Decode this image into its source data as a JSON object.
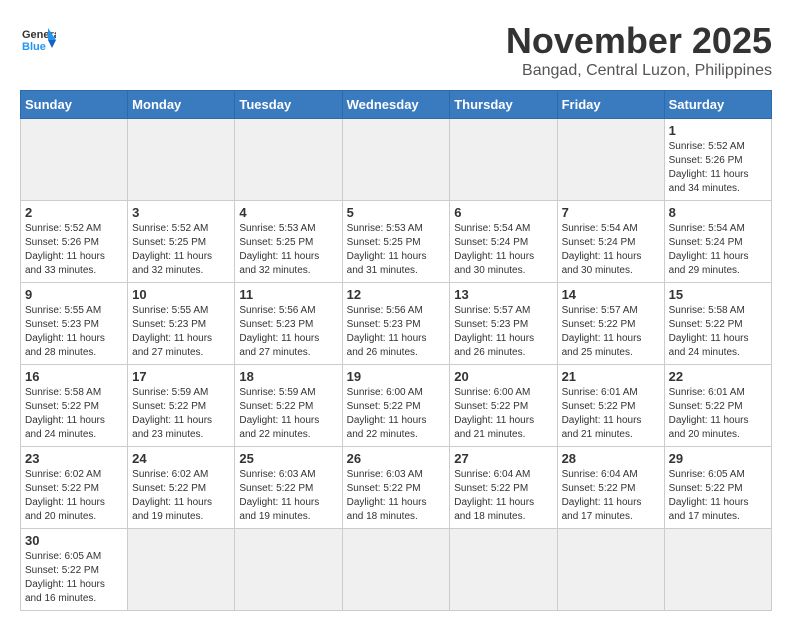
{
  "header": {
    "logo_general": "General",
    "logo_blue": "Blue",
    "month_title": "November 2025",
    "location": "Bangad, Central Luzon, Philippines"
  },
  "weekdays": [
    "Sunday",
    "Monday",
    "Tuesday",
    "Wednesday",
    "Thursday",
    "Friday",
    "Saturday"
  ],
  "weeks": [
    [
      {
        "day": "",
        "info": ""
      },
      {
        "day": "",
        "info": ""
      },
      {
        "day": "",
        "info": ""
      },
      {
        "day": "",
        "info": ""
      },
      {
        "day": "",
        "info": ""
      },
      {
        "day": "",
        "info": ""
      },
      {
        "day": "1",
        "info": "Sunrise: 5:52 AM\nSunset: 5:26 PM\nDaylight: 11 hours\nand 34 minutes."
      }
    ],
    [
      {
        "day": "2",
        "info": "Sunrise: 5:52 AM\nSunset: 5:26 PM\nDaylight: 11 hours\nand 33 minutes."
      },
      {
        "day": "3",
        "info": "Sunrise: 5:52 AM\nSunset: 5:25 PM\nDaylight: 11 hours\nand 32 minutes."
      },
      {
        "day": "4",
        "info": "Sunrise: 5:53 AM\nSunset: 5:25 PM\nDaylight: 11 hours\nand 32 minutes."
      },
      {
        "day": "5",
        "info": "Sunrise: 5:53 AM\nSunset: 5:25 PM\nDaylight: 11 hours\nand 31 minutes."
      },
      {
        "day": "6",
        "info": "Sunrise: 5:54 AM\nSunset: 5:24 PM\nDaylight: 11 hours\nand 30 minutes."
      },
      {
        "day": "7",
        "info": "Sunrise: 5:54 AM\nSunset: 5:24 PM\nDaylight: 11 hours\nand 30 minutes."
      },
      {
        "day": "8",
        "info": "Sunrise: 5:54 AM\nSunset: 5:24 PM\nDaylight: 11 hours\nand 29 minutes."
      }
    ],
    [
      {
        "day": "9",
        "info": "Sunrise: 5:55 AM\nSunset: 5:23 PM\nDaylight: 11 hours\nand 28 minutes."
      },
      {
        "day": "10",
        "info": "Sunrise: 5:55 AM\nSunset: 5:23 PM\nDaylight: 11 hours\nand 27 minutes."
      },
      {
        "day": "11",
        "info": "Sunrise: 5:56 AM\nSunset: 5:23 PM\nDaylight: 11 hours\nand 27 minutes."
      },
      {
        "day": "12",
        "info": "Sunrise: 5:56 AM\nSunset: 5:23 PM\nDaylight: 11 hours\nand 26 minutes."
      },
      {
        "day": "13",
        "info": "Sunrise: 5:57 AM\nSunset: 5:23 PM\nDaylight: 11 hours\nand 26 minutes."
      },
      {
        "day": "14",
        "info": "Sunrise: 5:57 AM\nSunset: 5:22 PM\nDaylight: 11 hours\nand 25 minutes."
      },
      {
        "day": "15",
        "info": "Sunrise: 5:58 AM\nSunset: 5:22 PM\nDaylight: 11 hours\nand 24 minutes."
      }
    ],
    [
      {
        "day": "16",
        "info": "Sunrise: 5:58 AM\nSunset: 5:22 PM\nDaylight: 11 hours\nand 24 minutes."
      },
      {
        "day": "17",
        "info": "Sunrise: 5:59 AM\nSunset: 5:22 PM\nDaylight: 11 hours\nand 23 minutes."
      },
      {
        "day": "18",
        "info": "Sunrise: 5:59 AM\nSunset: 5:22 PM\nDaylight: 11 hours\nand 22 minutes."
      },
      {
        "day": "19",
        "info": "Sunrise: 6:00 AM\nSunset: 5:22 PM\nDaylight: 11 hours\nand 22 minutes."
      },
      {
        "day": "20",
        "info": "Sunrise: 6:00 AM\nSunset: 5:22 PM\nDaylight: 11 hours\nand 21 minutes."
      },
      {
        "day": "21",
        "info": "Sunrise: 6:01 AM\nSunset: 5:22 PM\nDaylight: 11 hours\nand 21 minutes."
      },
      {
        "day": "22",
        "info": "Sunrise: 6:01 AM\nSunset: 5:22 PM\nDaylight: 11 hours\nand 20 minutes."
      }
    ],
    [
      {
        "day": "23",
        "info": "Sunrise: 6:02 AM\nSunset: 5:22 PM\nDaylight: 11 hours\nand 20 minutes."
      },
      {
        "day": "24",
        "info": "Sunrise: 6:02 AM\nSunset: 5:22 PM\nDaylight: 11 hours\nand 19 minutes."
      },
      {
        "day": "25",
        "info": "Sunrise: 6:03 AM\nSunset: 5:22 PM\nDaylight: 11 hours\nand 19 minutes."
      },
      {
        "day": "26",
        "info": "Sunrise: 6:03 AM\nSunset: 5:22 PM\nDaylight: 11 hours\nand 18 minutes."
      },
      {
        "day": "27",
        "info": "Sunrise: 6:04 AM\nSunset: 5:22 PM\nDaylight: 11 hours\nand 18 minutes."
      },
      {
        "day": "28",
        "info": "Sunrise: 6:04 AM\nSunset: 5:22 PM\nDaylight: 11 hours\nand 17 minutes."
      },
      {
        "day": "29",
        "info": "Sunrise: 6:05 AM\nSunset: 5:22 PM\nDaylight: 11 hours\nand 17 minutes."
      }
    ],
    [
      {
        "day": "30",
        "info": "Sunrise: 6:05 AM\nSunset: 5:22 PM\nDaylight: 11 hours\nand 16 minutes."
      },
      {
        "day": "",
        "info": ""
      },
      {
        "day": "",
        "info": ""
      },
      {
        "day": "",
        "info": ""
      },
      {
        "day": "",
        "info": ""
      },
      {
        "day": "",
        "info": ""
      },
      {
        "day": "",
        "info": ""
      }
    ]
  ]
}
